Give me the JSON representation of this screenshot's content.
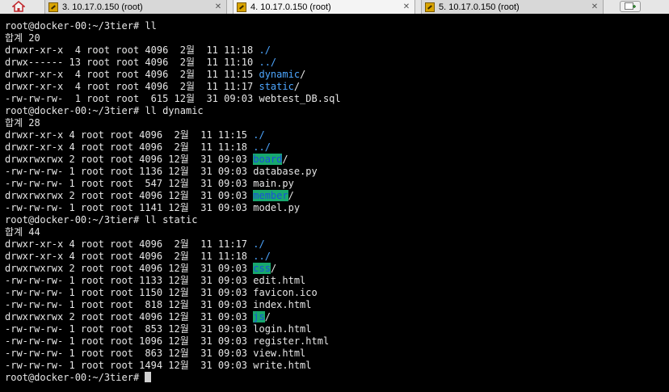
{
  "tabs": [
    {
      "label": "3. 10.17.0.150 (root)",
      "active": false
    },
    {
      "label": "4. 10.17.0.150 (root)",
      "active": true
    },
    {
      "label": "5. 10.17.0.150 (root)",
      "active": false
    }
  ],
  "icons": {
    "home": "home-icon",
    "tab": "ssh-session-icon",
    "close": "close-icon",
    "new_tab": "new-tab-icon"
  },
  "colors": {
    "background": "#000000",
    "text": "#e6e6e6",
    "directory": "#4da6ff",
    "world_writable_bg": "#17a86e",
    "world_writable_fg": "#1c4fd8"
  },
  "terminal": {
    "lines": [
      {
        "text": "root@docker-00:~/3tier# ll"
      },
      {
        "text": "합계 20"
      },
      {
        "text": "drwxr-xr-x  4 root root 4096  2월  11 11:18 ",
        "name": "./",
        "kind": "dir"
      },
      {
        "text": "drwx------ 13 root root 4096  2월  11 11:10 ",
        "name": "../",
        "kind": "dir"
      },
      {
        "text": "drwxr-xr-x  4 root root 4096  2월  11 11:15 ",
        "name": "dynamic",
        "kind": "dir",
        "suffix": "/"
      },
      {
        "text": "drwxr-xr-x  4 root root 4096  2월  11 11:17 ",
        "name": "static",
        "kind": "dir",
        "suffix": "/"
      },
      {
        "text": "-rw-rw-rw-  1 root root  615 12월  31 09:03 webtest_DB.sql"
      },
      {
        "text": "root@docker-00:~/3tier# ll dynamic"
      },
      {
        "text": "합계 28"
      },
      {
        "text": "drwxr-xr-x 4 root root 4096  2월  11 11:15 ",
        "name": "./",
        "kind": "dir"
      },
      {
        "text": "drwxr-xr-x 4 root root 4096  2월  11 11:18 ",
        "name": "../",
        "kind": "dir"
      },
      {
        "text": "drwxrwxrwx 2 root root 4096 12월  31 09:03 ",
        "name": "board",
        "kind": "hl",
        "suffix": "/"
      },
      {
        "text": "-rw-rw-rw- 1 root root 1136 12월  31 09:03 database.py"
      },
      {
        "text": "-rw-rw-rw- 1 root root  547 12월  31 09:03 main.py"
      },
      {
        "text": "drwxrwxrwx 2 root root 4096 12월  31 09:03 ",
        "name": "member",
        "kind": "hl",
        "suffix": "/"
      },
      {
        "text": "-rw-rw-rw- 1 root root 1141 12월  31 09:03 model.py"
      },
      {
        "text": "root@docker-00:~/3tier# ll static"
      },
      {
        "text": "합계 44"
      },
      {
        "text": "drwxr-xr-x 4 root root 4096  2월  11 11:17 ",
        "name": "./",
        "kind": "dir"
      },
      {
        "text": "drwxr-xr-x 4 root root 4096  2월  11 11:18 ",
        "name": "../",
        "kind": "dir"
      },
      {
        "text": "drwxrwxrwx 2 root root 4096 12월  31 09:03 ",
        "name": "css",
        "kind": "hl",
        "suffix": "/"
      },
      {
        "text": "-rw-rw-rw- 1 root root 1133 12월  31 09:03 edit.html"
      },
      {
        "text": "-rw-rw-rw- 1 root root 1150 12월  31 09:03 favicon.ico"
      },
      {
        "text": "-rw-rw-rw- 1 root root  818 12월  31 09:03 index.html"
      },
      {
        "text": "drwxrwxrwx 2 root root 4096 12월  31 09:03 ",
        "name": "js",
        "kind": "hl",
        "suffix": "/"
      },
      {
        "text": "-rw-rw-rw- 1 root root  853 12월  31 09:03 login.html"
      },
      {
        "text": "-rw-rw-rw- 1 root root 1096 12월  31 09:03 register.html"
      },
      {
        "text": "-rw-rw-rw- 1 root root  863 12월  31 09:03 view.html"
      },
      {
        "text": "-rw-rw-rw- 1 root root 1494 12월  31 09:03 write.html"
      }
    ],
    "prompt": "root@docker-00:~/3tier# "
  }
}
